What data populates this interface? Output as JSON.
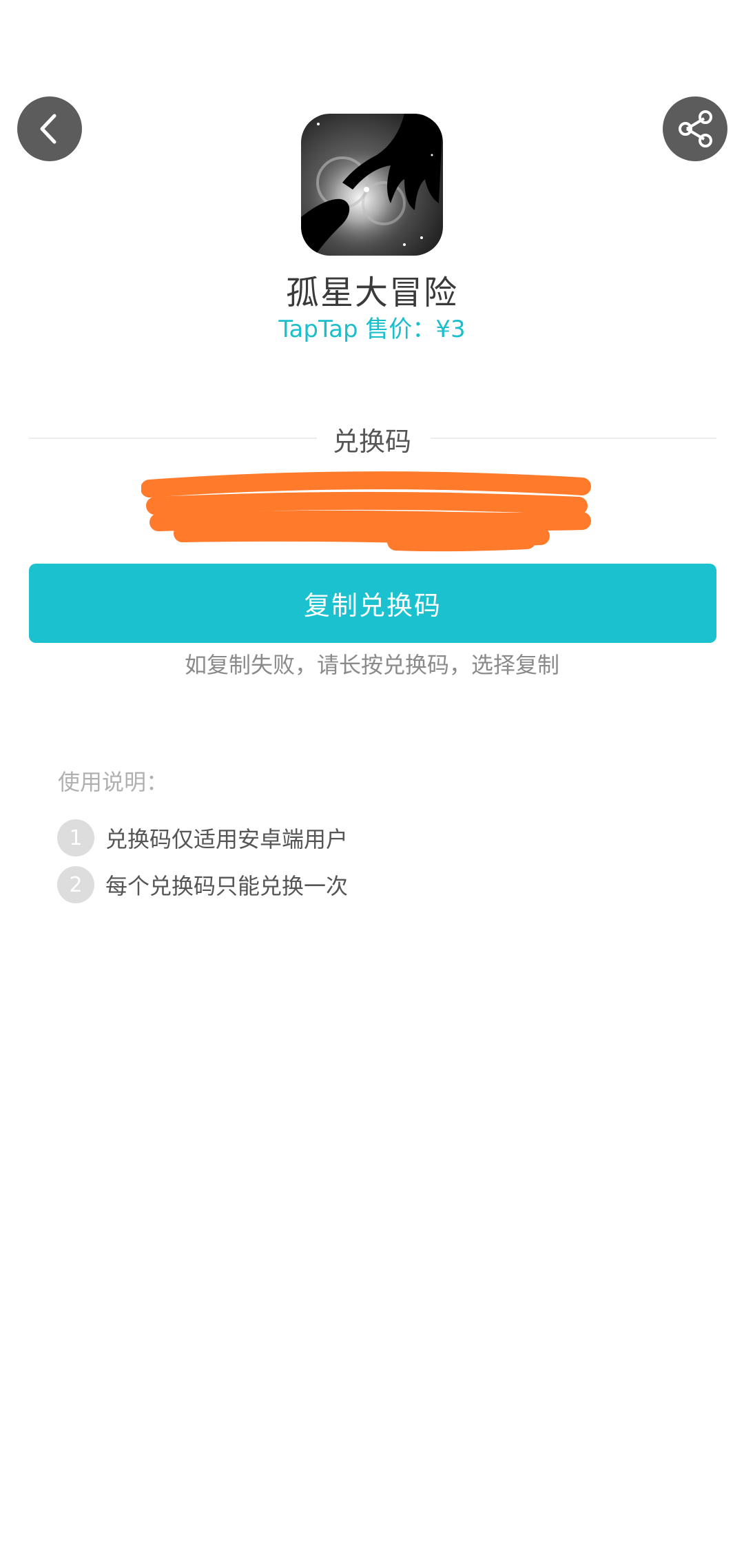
{
  "header": {
    "back_icon": "chevron-left-icon",
    "share_icon": "share-icon"
  },
  "app": {
    "title": "孤星大冒险",
    "price": "TapTap 售价：¥3"
  },
  "redeem": {
    "section_label": "兑换码",
    "code_redacted": true,
    "redaction_color": "#ff7a2a",
    "copy_button_label": "复制兑换码",
    "hint": "如复制失败，请长按兑换码，选择复制"
  },
  "instructions": {
    "title": "使用说明：",
    "items": [
      {
        "number": "1",
        "text": "兑换码仅适用安卓端用户"
      },
      {
        "number": "2",
        "text": "每个兑换码只能兑换一次"
      }
    ]
  },
  "colors": {
    "accent": "#1cc1cf",
    "price": "#1bbfcc",
    "circle_button": "#5c5c5c"
  }
}
